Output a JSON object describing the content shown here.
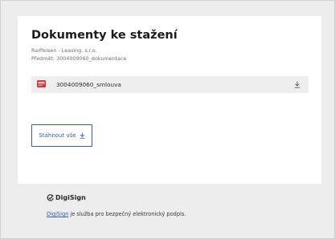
{
  "card": {
    "title": "Dokumenty ke stažení",
    "sender": "Raiffeisen - Leasing, s.r.o.",
    "subject": "Předmět: 3004009060_dokumentace"
  },
  "files": [
    {
      "name": "3004009060_smlouva",
      "icon": "pdf-file-icon",
      "action_icon": "download-icon"
    }
  ],
  "actions": {
    "download_all_label": "Stáhnout vše",
    "download_all_icon": "download-icon"
  },
  "footer": {
    "brand_name": "DigiSign",
    "brand_icon": "digisign-logo-icon",
    "link_text": "DigiSign",
    "text_rest": " je služba pro bezpečný elektronický podpis."
  },
  "colors": {
    "accent": "#2f5fb8",
    "pdf_icon": "#d9343a",
    "background": "#ededed",
    "card": "#ffffff",
    "file_row": "#eeeeee"
  }
}
